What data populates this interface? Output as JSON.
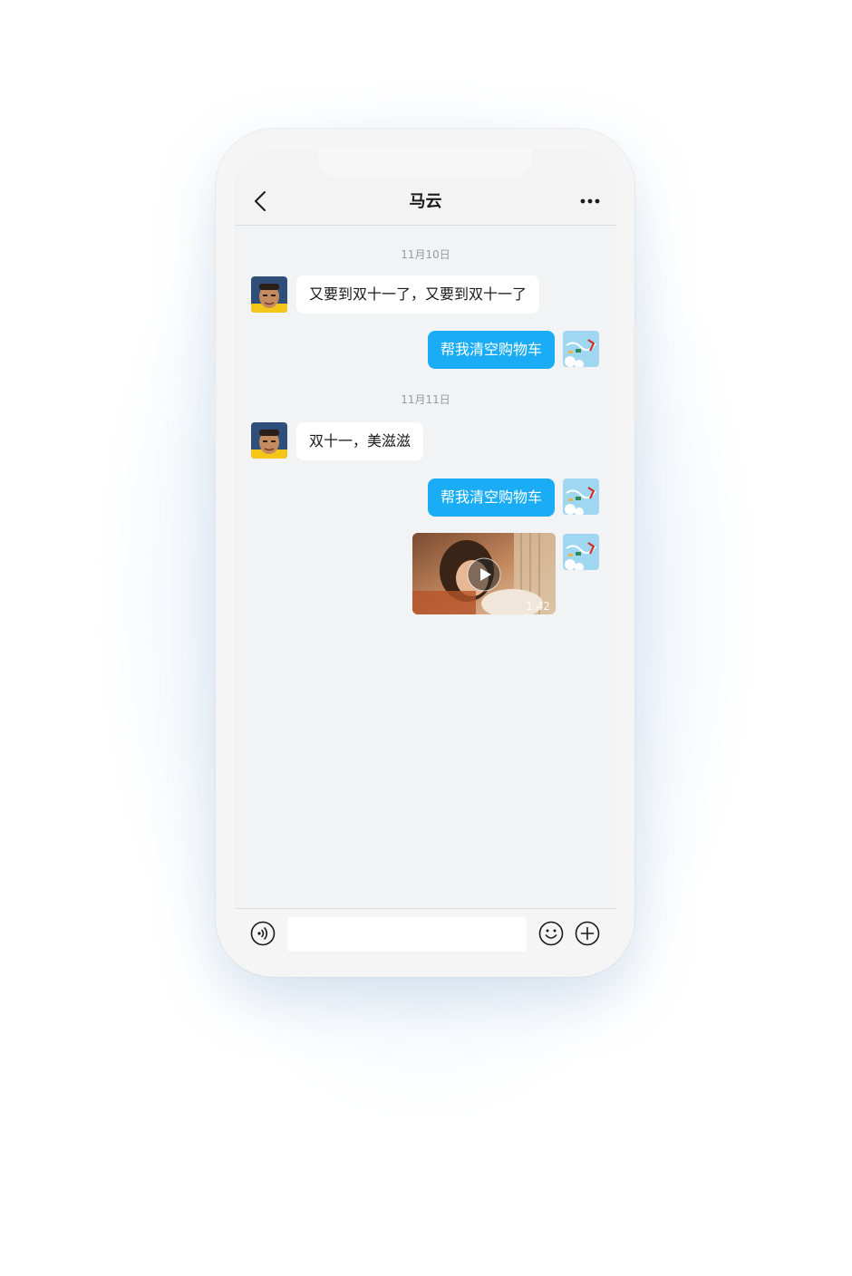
{
  "header": {
    "title": "马云",
    "back_icon": "chevron-left-icon",
    "more_icon": "more-dots-icon"
  },
  "messages": [
    {
      "type": "date",
      "text": "11月10日"
    },
    {
      "type": "text",
      "side": "incoming",
      "text": "又要到双十一了，又要到双十一了",
      "avatar": "contact-avatar"
    },
    {
      "type": "text",
      "side": "outgoing",
      "text": "帮我清空购物车",
      "avatar": "my-avatar"
    },
    {
      "type": "date",
      "text": "11月11日"
    },
    {
      "type": "text",
      "side": "incoming",
      "text": "双十一，美滋滋",
      "avatar": "contact-avatar"
    },
    {
      "type": "text",
      "side": "outgoing",
      "text": "帮我清空购物车",
      "avatar": "my-avatar"
    },
    {
      "type": "video",
      "side": "outgoing",
      "duration": "1.42",
      "avatar": "my-avatar"
    }
  ],
  "input_bar": {
    "voice_icon": "voice-icon",
    "text_value": "",
    "emoji_icon": "emoji-icon",
    "plus_icon": "plus-icon"
  },
  "colors": {
    "outgoing_bubble": "#1aadf5",
    "incoming_bubble": "#ffffff",
    "chat_background": "#f2f3f5"
  }
}
